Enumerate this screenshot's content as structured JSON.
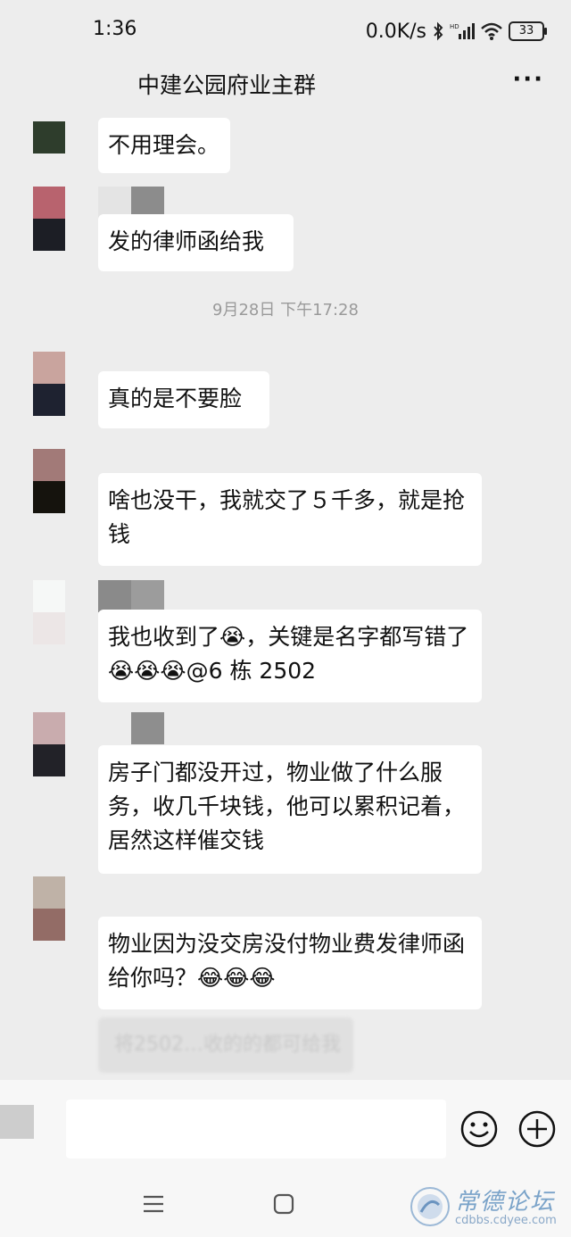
{
  "status_bar": {
    "time": "1:36",
    "net_speed": "0.0K/s",
    "battery": "33"
  },
  "header": {
    "title": "中建公园府业主群"
  },
  "timestamp": "9月28日 下午17:28",
  "messages": [
    {
      "text": "不用理会。"
    },
    {
      "text": "发的律师函给我"
    },
    {
      "text": "真的是不要脸"
    },
    {
      "text": "啥也没干，我就交了５千多，就是抢钱"
    },
    {
      "text": "我也收到了😭，关键是名字都写错了😭😭😭@6 栋 2502"
    },
    {
      "text": "房子门都没开过，物业做了什么服务，收几千块钱，他可以累积记着，居然这样催交钱"
    },
    {
      "text": "物业因为没交房没付物业费发律师函给你吗？😂😂😂"
    }
  ],
  "faded_message": "将2502…收的的都可给我",
  "input": {
    "value": "",
    "placeholder": ""
  },
  "watermark": {
    "title": "常德论坛",
    "url": "cdbbs.cdyee.com"
  }
}
